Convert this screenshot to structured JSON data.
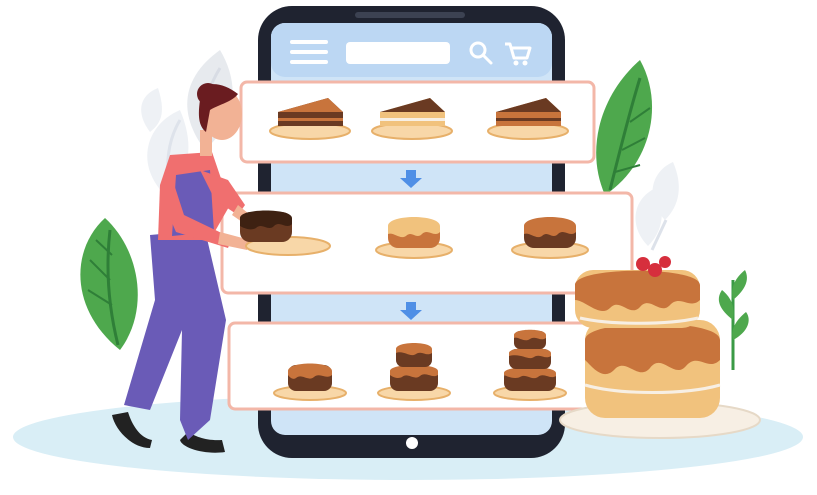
{
  "app": {
    "search": {
      "placeholder": ""
    },
    "icons": {
      "menu": "hamburger-menu-icon",
      "search": "search-icon",
      "cart": "cart-icon",
      "arrow": "arrow-down-icon",
      "home": "home-button-icon"
    }
  },
  "colors": {
    "background": "#ffffff",
    "floor": "#d9eef6",
    "phone_body": "#1f2330",
    "screen": "#cfe4f7",
    "header_bar": "#bcd7f3",
    "card": "#ffffff",
    "card_border": "#f3b7a8",
    "plate": "#f8d7a8",
    "plate_edge": "#e7b06a",
    "cake_choc": "#6a3a22",
    "cake_caramel": "#c8743c",
    "cake_light": "#f1c27d",
    "icing_white": "#f7efe4",
    "leaf_green": "#4ea84d",
    "leaf_gray": "#e6e9ee",
    "apron": "#6a5bb7",
    "shirt": "#f06f6f",
    "hair": "#6a1c20",
    "skin": "#f2b295",
    "berry": "#d62f3d",
    "arrow_blue": "#4f8fe6"
  }
}
